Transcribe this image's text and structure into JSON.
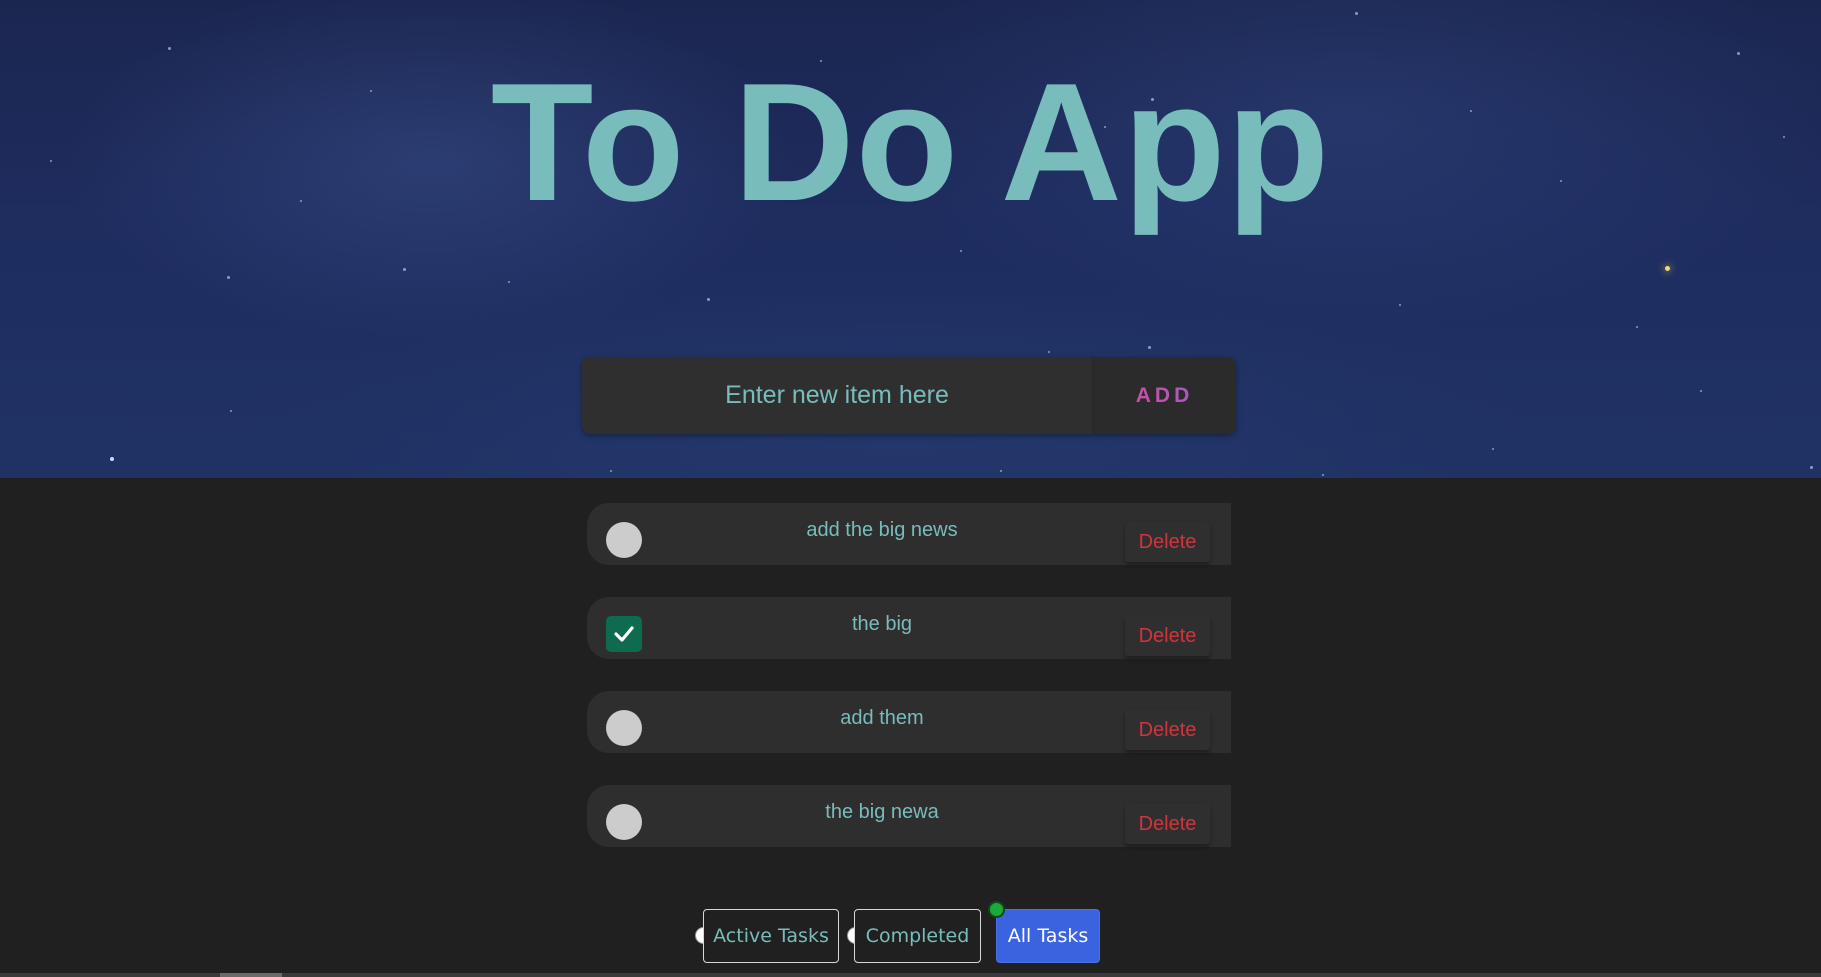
{
  "app": {
    "title": "To Do App"
  },
  "add_bar": {
    "placeholder": "Enter new item here",
    "button_label": "ADD"
  },
  "tasks": [
    {
      "text": "add the big news",
      "completed": false,
      "delete_label": "Delete"
    },
    {
      "text": "the big",
      "completed": true,
      "delete_label": "Delete"
    },
    {
      "text": "add them",
      "completed": false,
      "delete_label": "Delete"
    },
    {
      "text": "the big newa",
      "completed": false,
      "delete_label": "Delete"
    }
  ],
  "filters": [
    {
      "label": "Active Tasks",
      "selected": false
    },
    {
      "label": "Completed",
      "selected": false
    },
    {
      "label": "All Tasks",
      "selected": true
    }
  ],
  "colors": {
    "accent_teal": "#78bcbc",
    "delete_red": "#d2343c",
    "checked_green": "#0f6b4f",
    "filter_active_blue": "#3b63e0",
    "page_background": "#202020"
  }
}
